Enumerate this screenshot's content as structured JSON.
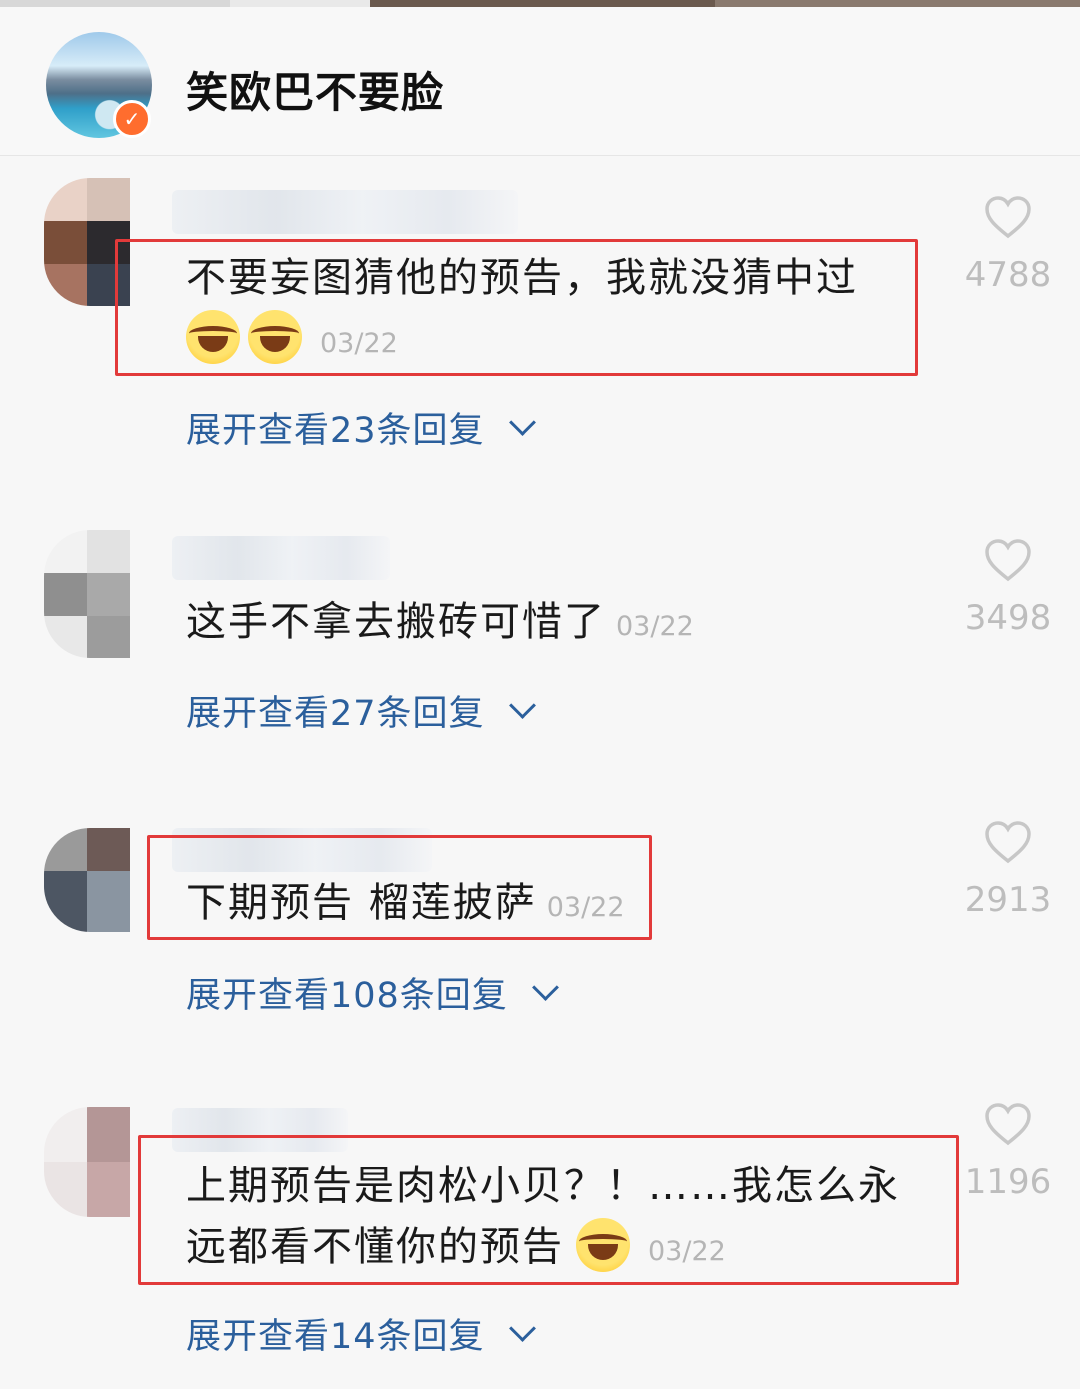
{
  "profile": {
    "name": "笑欧巴不要脸"
  },
  "comments": [
    {
      "text": "不要妄图猜他的预告，我就没猜中过",
      "date": "03/22",
      "likes": "4788",
      "replies": "展开查看23条回复"
    },
    {
      "text": "这手不拿去搬砖可惜了",
      "date": "03/22",
      "likes": "3498",
      "replies": "展开查看27条回复"
    },
    {
      "text": "下期预告 榴莲披萨",
      "date": "03/22",
      "likes": "2913",
      "replies": "展开查看108条回复"
    },
    {
      "text_line1": "上期预告是肉松小贝？！……我怎么永",
      "text_line2": "远都看不懂你的预告",
      "date": "03/22",
      "likes": "1196",
      "replies": "展开查看14条回复"
    }
  ],
  "icons": {
    "like": "heart-outline-icon",
    "expand": "chevron-down-icon",
    "verified": "verified-check-icon"
  },
  "colors": {
    "link": "#2b5f9c",
    "highlight_box": "#e23a3a",
    "badge": "#ff6d2e"
  }
}
